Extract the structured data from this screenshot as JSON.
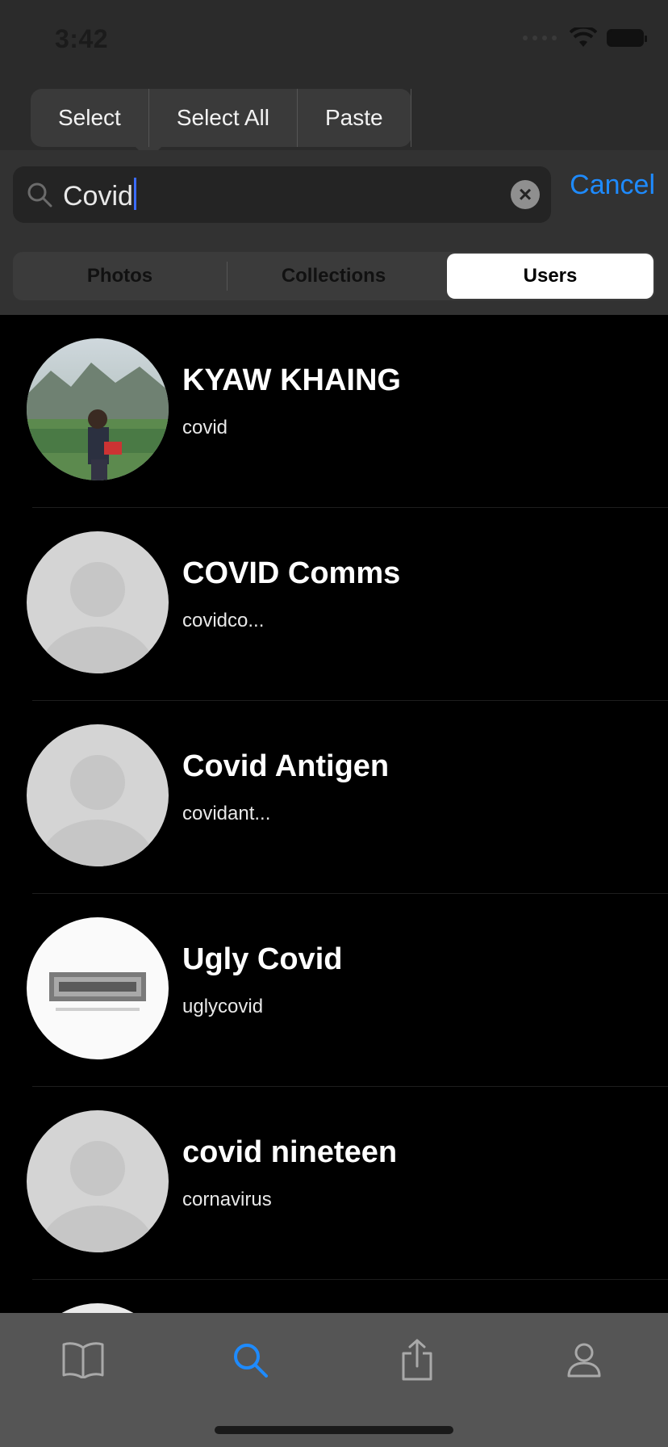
{
  "status_bar": {
    "time": "3:42"
  },
  "edit_menu": {
    "items": [
      "Select",
      "Select All",
      "Paste"
    ]
  },
  "search": {
    "value": "Covid",
    "cancel_label": "Cancel"
  },
  "segments": {
    "items": [
      "Photos",
      "Collections",
      "Users"
    ],
    "selected": "Users"
  },
  "users": [
    {
      "name": "KYAW KHAING",
      "handle": "covid",
      "avatar": "photo"
    },
    {
      "name": "COVID Comms",
      "handle": "covidco...",
      "avatar": "placeholder"
    },
    {
      "name": "Covid Antigen",
      "handle": "covidant...",
      "avatar": "placeholder"
    },
    {
      "name": "Ugly Covid",
      "handle": "uglycovid",
      "avatar": "logo"
    },
    {
      "name": "covid nineteen",
      "handle": "cornavirus",
      "avatar": "placeholder"
    }
  ],
  "tab_bar": {
    "items": [
      {
        "icon": "book-icon",
        "active": false
      },
      {
        "icon": "search-icon",
        "active": true
      },
      {
        "icon": "share-icon",
        "active": false
      },
      {
        "icon": "person-icon",
        "active": false
      }
    ],
    "active_color": "#1e8bff",
    "inactive_color": "#a9a9a9"
  },
  "colors": {
    "accent": "#1e8bff",
    "background": "#000000"
  }
}
